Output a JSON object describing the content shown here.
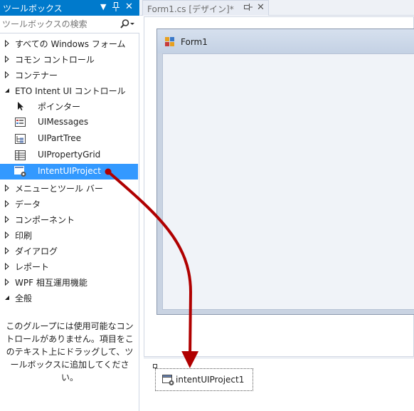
{
  "toolbox": {
    "title": "ツールボックス",
    "search_placeholder": "ツールボックスの検索",
    "categories_top": [
      {
        "label": "すべての Windows フォーム",
        "expanded": false
      },
      {
        "label": "コモン コントロール",
        "expanded": false
      },
      {
        "label": "コンテナー",
        "expanded": false
      },
      {
        "label": "ETO Intent UI コントロール",
        "expanded": true
      }
    ],
    "eto_items": [
      {
        "label": "ポインター",
        "icon": "pointer-icon",
        "selected": false
      },
      {
        "label": "UIMessages",
        "icon": "messages-control-icon",
        "selected": false
      },
      {
        "label": "UIPartTree",
        "icon": "tree-control-icon",
        "selected": false
      },
      {
        "label": "UIPropertyGrid",
        "icon": "property-grid-icon",
        "selected": false
      },
      {
        "label": "IntentUIProject",
        "icon": "component-icon",
        "selected": true
      }
    ],
    "categories_bottom": [
      {
        "label": "メニューとツール バー",
        "expanded": false
      },
      {
        "label": "データ",
        "expanded": false
      },
      {
        "label": "コンポーネント",
        "expanded": false
      },
      {
        "label": "印刷",
        "expanded": false
      },
      {
        "label": "ダイアログ",
        "expanded": false
      },
      {
        "label": "レポート",
        "expanded": false
      },
      {
        "label": "WPF 相互運用機能",
        "expanded": false
      },
      {
        "label": "全般",
        "expanded": true
      }
    ],
    "empty_message": "このグループには使用可能なコントロールがありません。項目をこのテキスト上にドラッグして、ツールボックスに追加してください。"
  },
  "document": {
    "tab_label": "Form1.cs [デザイン]*"
  },
  "form": {
    "title": "Form1"
  },
  "tray": {
    "component_label": "intentUIProject1"
  },
  "colors": {
    "title_bar": "#007acc",
    "selection": "#3399ff",
    "drag_arrow": "#b00000"
  }
}
